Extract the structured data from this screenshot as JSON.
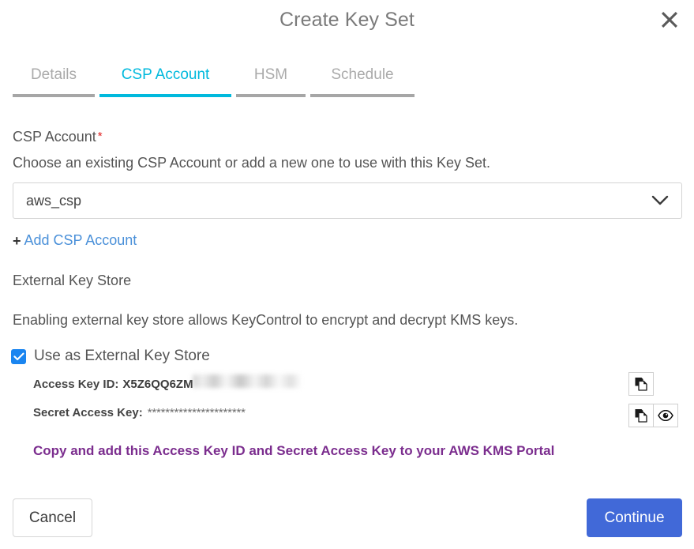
{
  "dialog": {
    "title": "Create Key Set",
    "close_icon": "close-icon"
  },
  "tabs": [
    {
      "label": "Details",
      "active": false
    },
    {
      "label": "CSP Account",
      "active": true
    },
    {
      "label": "HSM",
      "active": false
    },
    {
      "label": "Schedule",
      "active": false
    }
  ],
  "csp_account": {
    "label": "CSP Account",
    "required_marker": "*",
    "help": "Choose an existing CSP Account or add a new one to use with this Key Set.",
    "selected_value": "aws_csp",
    "dropdown_icon": "chevron-down-icon",
    "add_link": "Add CSP Account",
    "add_link_plus": "+"
  },
  "external_key_store": {
    "section_title": "External Key Store",
    "description": "Enabling external key store allows KeyControl to encrypt and decrypt KMS keys.",
    "checkbox_label": "Use as External Key Store",
    "checkbox_checked": true,
    "access_key_id_label": "Access Key ID:",
    "access_key_id_value": "X5Z6QQ6ZM",
    "access_key_id_redacted": true,
    "secret_access_key_label": "Secret Access Key:",
    "secret_access_key_value": "**********************",
    "copy_access_key_id_icon": "copy-icon",
    "copy_secret_key_icon": "copy-icon",
    "show_secret_key_icon": "eye-icon",
    "notice": "Copy and add this Access Key ID and Secret Access Key to your AWS KMS Portal"
  },
  "footer": {
    "cancel_label": "Cancel",
    "continue_label": "Continue"
  },
  "colors": {
    "accent_tab": "#00b9dd",
    "link_blue": "#4a90d9",
    "checkbox_blue": "#1a85f0",
    "primary_button": "#4169d8",
    "notice_purple": "#7b2d8e",
    "required_red": "#e02020"
  }
}
